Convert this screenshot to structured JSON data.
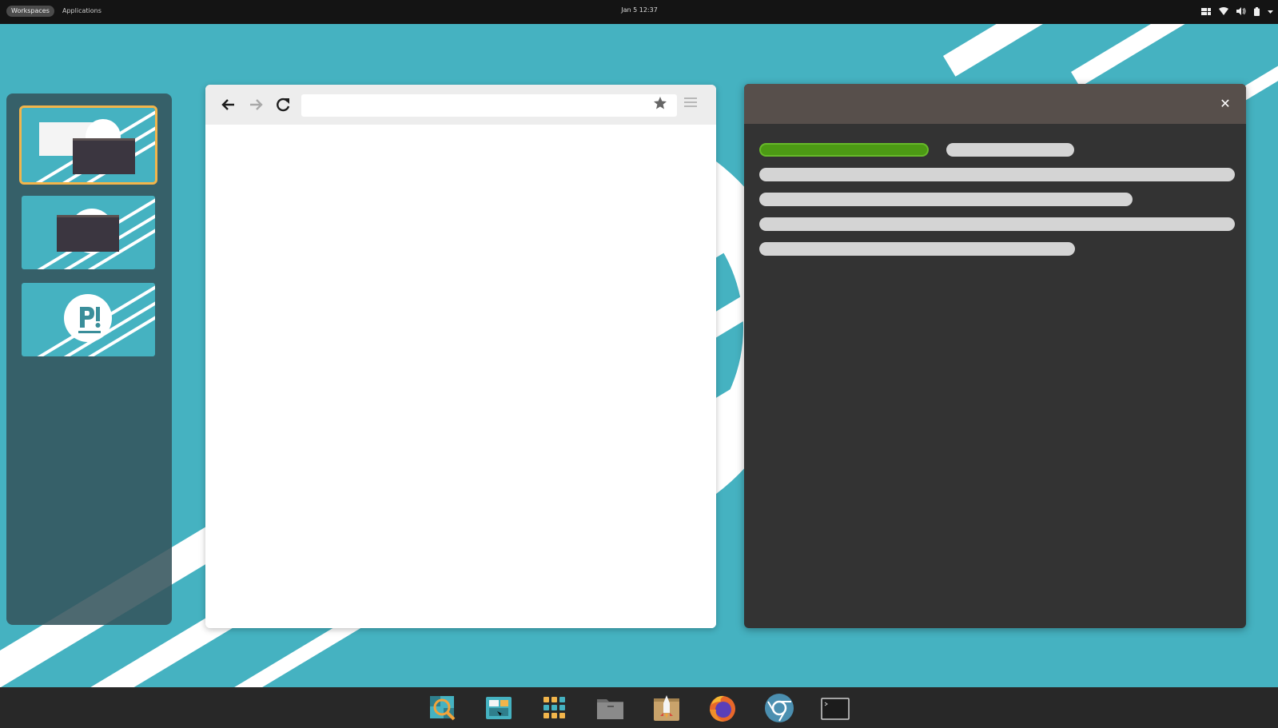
{
  "topbar": {
    "workspaces_label": "Workspaces",
    "applications_label": "Applications",
    "clock": "Jan 5  12:37",
    "tray_icons": [
      "workspace-layout-icon",
      "wifi-icon",
      "volume-icon",
      "battery-icon",
      "chevron-down-icon"
    ]
  },
  "workspaces": {
    "count": 3,
    "active_index": 0
  },
  "browser": {
    "url_value": "",
    "nav_icons": [
      "back-arrow-icon",
      "forward-arrow-icon",
      "reload-icon"
    ],
    "bookmark_icon": "star-icon",
    "menu_icon": "hamburger-menu-icon"
  },
  "dialog": {
    "close_icon": "close-icon",
    "accent_color": "#4c9a14"
  },
  "dock": {
    "apps": [
      "search-icon",
      "workspaces-icon",
      "app-grid-icon",
      "files-icon",
      "app-store-icon",
      "firefox-icon",
      "chromium-icon",
      "terminal-icon"
    ]
  },
  "colors": {
    "desktop_bg": "#45b2c1",
    "dialog_header": "#574f4b",
    "active_workspace_outline": "#f2b54b"
  }
}
